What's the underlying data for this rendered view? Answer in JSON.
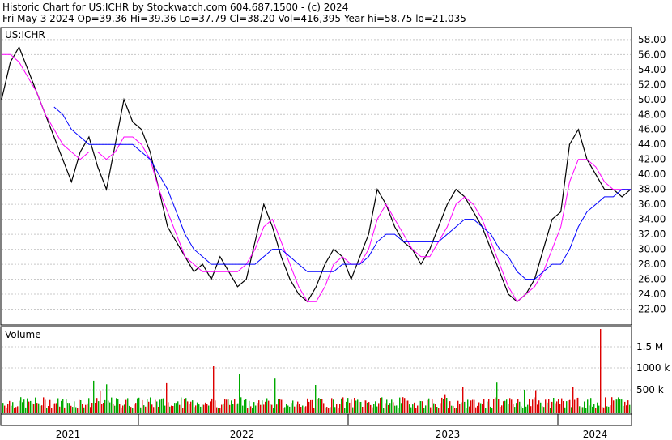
{
  "header": {
    "line1": "Historic Chart for US:ICHR by Stockwatch.com 604.687.1500 - (c) 2024",
    "line2": "Fri May  3 2024  Op=39.36  Hi=39.36  Lo=37.79  Cl=38.20  Vol=416,395  Year hi=58.75  lo=21.035"
  },
  "colors": {
    "price": "#000000",
    "ma_short": "#ff00ff",
    "ma_long": "#0000ff",
    "vol_up": "#00aa00",
    "vol_down": "#dd0000",
    "grid": "#c8c8c8"
  },
  "chart_data": [
    {
      "type": "line",
      "title": "US:ICHR",
      "ylim": [
        20,
        59.5
      ],
      "y_ticks": [
        "58.00",
        "56.00",
        "54.00",
        "52.00",
        "50.00",
        "48.00",
        "46.00",
        "44.00",
        "42.00",
        "40.00",
        "38.00",
        "36.00",
        "34.00",
        "32.00",
        "30.00",
        "28.00",
        "26.00",
        "24.00",
        "22.00"
      ],
      "x_labels": [
        "2021",
        "2022",
        "2023",
        "2024"
      ],
      "series": [
        {
          "key": "price",
          "values": [
            50,
            55,
            57,
            54,
            51,
            48,
            45,
            42,
            39,
            43,
            45,
            41,
            38,
            44,
            50,
            47,
            46,
            43,
            38,
            33,
            31,
            29,
            27,
            28,
            26,
            29,
            27,
            25,
            26,
            31,
            36,
            33,
            29,
            26,
            24,
            23,
            25,
            28,
            30,
            29,
            26,
            29,
            32,
            38,
            36,
            33,
            31,
            30,
            28,
            30,
            33,
            36,
            38,
            37,
            35,
            33,
            30,
            27,
            24,
            23,
            24,
            26,
            30,
            34,
            35,
            44,
            46,
            42,
            40,
            38,
            38,
            37,
            38
          ]
        },
        {
          "key": "ma_short",
          "values": [
            56,
            56,
            55,
            53,
            51,
            48,
            46,
            44,
            43,
            42,
            43,
            43,
            42,
            43,
            45,
            45,
            44,
            42,
            38,
            35,
            32,
            29,
            28,
            27,
            27,
            27,
            27,
            27,
            28,
            30,
            33,
            34,
            31,
            28,
            25,
            23,
            23,
            25,
            28,
            29,
            28,
            28,
            30,
            34,
            36,
            34,
            32,
            30,
            29,
            29,
            31,
            33,
            36,
            37,
            36,
            34,
            31,
            28,
            25,
            23,
            24,
            25,
            27,
            30,
            33,
            39,
            42,
            42,
            41,
            39,
            38,
            38,
            38
          ]
        },
        {
          "key": "ma_long",
          "values": [
            null,
            null,
            null,
            null,
            null,
            null,
            49,
            48,
            46,
            45,
            44,
            44,
            44,
            44,
            44,
            44,
            43,
            42,
            40,
            38,
            35,
            32,
            30,
            29,
            28,
            28,
            28,
            28,
            28,
            28,
            29,
            30,
            30,
            29,
            28,
            27,
            27,
            27,
            27,
            28,
            28,
            28,
            29,
            31,
            32,
            32,
            31,
            31,
            31,
            31,
            31,
            32,
            33,
            34,
            34,
            33,
            32,
            30,
            29,
            27,
            26,
            26,
            27,
            28,
            28,
            30,
            33,
            35,
            36,
            37,
            37,
            38,
            38
          ]
        }
      ]
    },
    {
      "type": "bar",
      "title": "Volume",
      "y_ticks": [
        "1.5 M",
        "1000 k",
        "500 k"
      ]
    }
  ]
}
